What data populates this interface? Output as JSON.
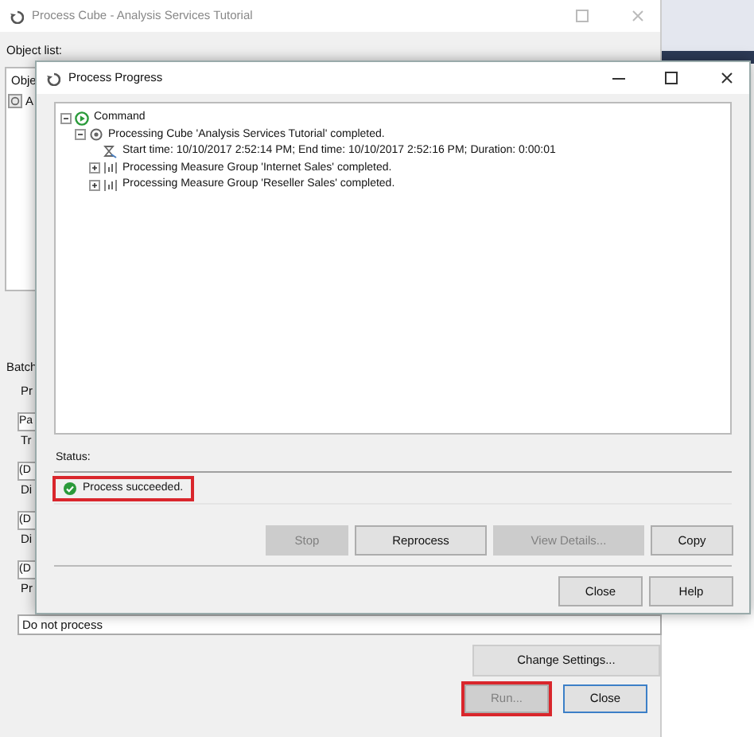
{
  "back_window": {
    "title": "Process Cube - Analysis Services Tutorial",
    "object_list_label": "Object list:",
    "list_header": "Obje",
    "list_row": "A",
    "fragments": [
      {
        "kind": "heading",
        "text": "Batch"
      },
      {
        "kind": "label",
        "text": "Pr"
      },
      {
        "kind": "field",
        "text": "Pa"
      },
      {
        "kind": "label",
        "text": "Tr"
      },
      {
        "kind": "field",
        "text": "(D"
      },
      {
        "kind": "label",
        "text": "Di"
      },
      {
        "kind": "field",
        "text": "(D"
      },
      {
        "kind": "label",
        "text": "Di"
      },
      {
        "kind": "field",
        "text": "(D"
      },
      {
        "kind": "label",
        "text": "Pr"
      }
    ],
    "process_field": "Do not process",
    "change_settings_button": "Change Settings...",
    "buttons": [
      {
        "label": "Run...",
        "disabled": true,
        "highlighted": true,
        "default": false
      },
      {
        "label": "Close",
        "disabled": false,
        "highlighted": false,
        "default": true
      }
    ]
  },
  "dialog": {
    "title": "Process Progress",
    "tree": [
      {
        "kind": "command",
        "text": "Command",
        "expanded": true,
        "children": [
          {
            "kind": "cube",
            "text": "Processing Cube 'Analysis Services Tutorial' completed.",
            "expanded": true,
            "children": [
              {
                "kind": "time",
                "text": "Start time: 10/10/2017 2:52:14 PM; End time: 10/10/2017 2:52:16 PM; Duration: 0:00:01"
              },
              {
                "kind": "measure_group",
                "text": "Processing Measure Group 'Internet Sales' completed.",
                "expanded": false
              },
              {
                "kind": "measure_group",
                "text": "Processing Measure Group 'Reseller Sales' completed.",
                "expanded": false
              }
            ]
          }
        ]
      }
    ],
    "status_label": "Status:",
    "status": {
      "text": "Process succeeded.",
      "highlighted": true
    },
    "buttons": [
      {
        "label": "Stop",
        "disabled": true
      },
      {
        "label": "Reprocess",
        "disabled": false
      },
      {
        "label": "View Details...",
        "disabled": true
      },
      {
        "label": "Copy",
        "disabled": false
      }
    ],
    "footer_buttons": [
      {
        "label": "Close",
        "disabled": false
      },
      {
        "label": "Help",
        "disabled": false
      }
    ]
  }
}
